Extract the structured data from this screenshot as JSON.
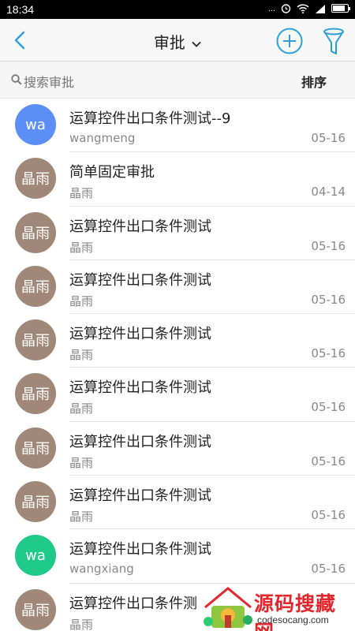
{
  "status_bar": {
    "time": "18:34",
    "signal_text": "...",
    "battery_level": 0.85
  },
  "nav": {
    "title": "审批"
  },
  "search": {
    "placeholder": "搜索审批",
    "sort_label": "排序"
  },
  "colors": {
    "accent": "#2a9fd8",
    "avatar_blue": "#5b8ff5",
    "avatar_brown": "#a08777",
    "avatar_green": "#1ec98a"
  },
  "items": [
    {
      "avatar_text": "wa",
      "avatar_color": "#5b8ff5",
      "title": "运算控件出口条件测试--9",
      "name": "wangmeng",
      "date": "05-16"
    },
    {
      "avatar_text": "晶雨",
      "avatar_color": "#a08777",
      "title": "简单固定审批",
      "name": "晶雨",
      "date": "04-14"
    },
    {
      "avatar_text": "晶雨",
      "avatar_color": "#a08777",
      "title": "运算控件出口条件测试",
      "name": "晶雨",
      "date": "05-16"
    },
    {
      "avatar_text": "晶雨",
      "avatar_color": "#a08777",
      "title": "运算控件出口条件测试",
      "name": "晶雨",
      "date": "05-16"
    },
    {
      "avatar_text": "晶雨",
      "avatar_color": "#a08777",
      "title": "运算控件出口条件测试",
      "name": "晶雨",
      "date": "05-16"
    },
    {
      "avatar_text": "晶雨",
      "avatar_color": "#a08777",
      "title": "运算控件出口条件测试",
      "name": "晶雨",
      "date": "05-16"
    },
    {
      "avatar_text": "晶雨",
      "avatar_color": "#a08777",
      "title": "运算控件出口条件测试",
      "name": "晶雨",
      "date": "05-16"
    },
    {
      "avatar_text": "晶雨",
      "avatar_color": "#a08777",
      "title": "运算控件出口条件测试",
      "name": "晶雨",
      "date": "05-16"
    },
    {
      "avatar_text": "wa",
      "avatar_color": "#1ec98a",
      "title": "运算控件出口条件测试",
      "name": "wangxiang",
      "date": "05-16"
    },
    {
      "avatar_text": "晶雨",
      "avatar_color": "#a08777",
      "title": "运算控件出口条件测",
      "name": "晶雨",
      "date": ""
    }
  ],
  "watermark": {
    "text": "源码搜藏网",
    "url": "codesocang.com"
  }
}
